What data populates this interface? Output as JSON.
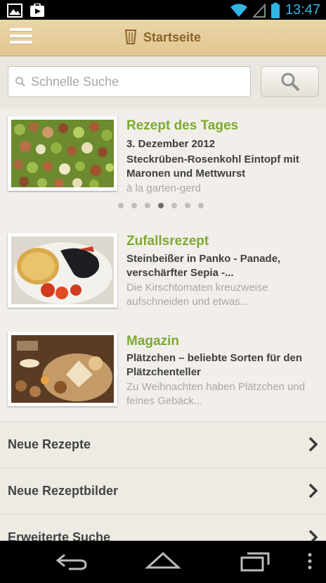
{
  "status_bar": {
    "time": "13:47"
  },
  "action_bar": {
    "title": "Startseite"
  },
  "search": {
    "placeholder": "Schnelle Suche"
  },
  "cards": [
    {
      "title": "Rezept des Tages",
      "date": "3. Dezember 2012",
      "headline": "Steckrüben-Rosenkohl Eintopf mit Maronen und Mettwurst",
      "subtitle": "à la garten-gerd"
    },
    {
      "title": "Zufallsrezept",
      "headline": "Steinbeißer in Panko - Panade, verschärfter Sepia -...",
      "subtitle": "Die Kirschtomaten kreuzweise aufschneiden und etwas..."
    },
    {
      "title": "Magazin",
      "headline": "Plätzchen – beliebte Sorten für den Plätzchenteller",
      "subtitle": "Zu Weihnachten haben Plätzchen und feines Gebäck..."
    }
  ],
  "carousel": {
    "pages": 7,
    "active_index": 3
  },
  "list": [
    {
      "label": "Neue Rezepte"
    },
    {
      "label": "Neue Rezeptbilder"
    },
    {
      "label": "Erweiterte Suche"
    }
  ],
  "colors": {
    "accent_green": "#7caa32",
    "title_brown": "#8a6328",
    "clock_blue": "#33b5e5"
  }
}
